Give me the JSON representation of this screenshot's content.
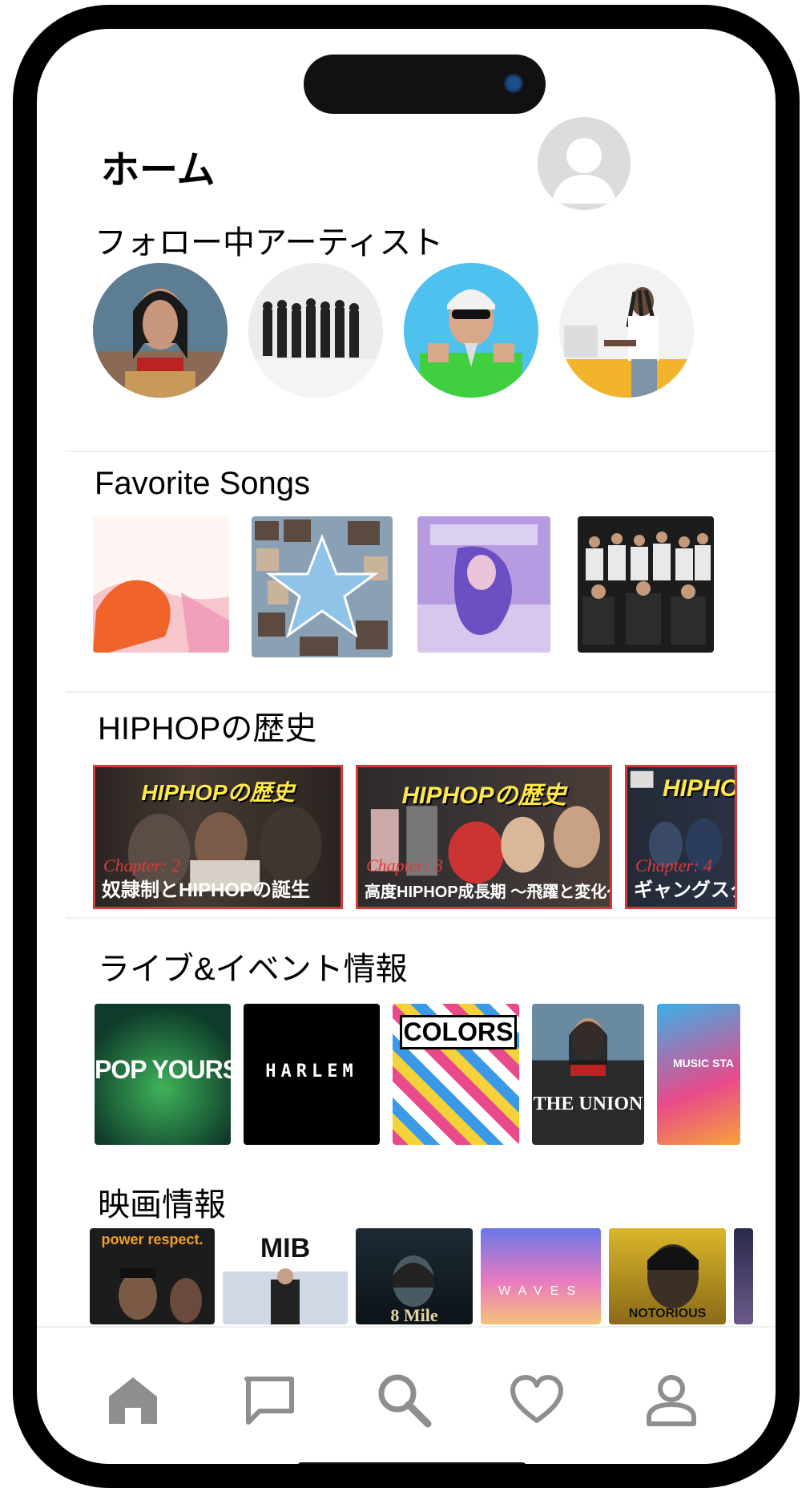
{
  "header": {
    "title": "ホーム",
    "profile_icon": "user-avatar-icon"
  },
  "sections": {
    "artists": {
      "title": "フォロー中アーティスト"
    },
    "songs": {
      "title": "Favorite Songs"
    },
    "history": {
      "title": "HIPHOPの歴史",
      "videos": [
        {
          "badge": "HIPHOPの歴史",
          "chapter": "Chapter: 2",
          "subtitle": "奴隷制とHIPHOPの誕生"
        },
        {
          "badge": "HIPHOPの歴史",
          "chapter": "Chapter: 3",
          "subtitle": "高度HIPHOP成長期 ～飛躍と変化～"
        },
        {
          "badge": "HIPHOP",
          "chapter": "Chapter: 4",
          "subtitle": "ギャングスタラ"
        }
      ]
    },
    "events": {
      "title": "ライブ&イベント情報",
      "items": [
        {
          "label": "POP YOURS"
        },
        {
          "label": "HARLEM"
        },
        {
          "label": "COLORS"
        },
        {
          "label": "THE UNION"
        },
        {
          "label": "MUSIC STA"
        }
      ]
    },
    "movies": {
      "title": "映画情報",
      "items": [
        {
          "label": "power respect."
        },
        {
          "label": "MIB"
        },
        {
          "label": "8 Mile"
        },
        {
          "label": "WAVES"
        },
        {
          "label": "NOTORIOUS"
        }
      ]
    }
  },
  "tabbar": {
    "items": [
      {
        "icon": "home-icon",
        "active": true
      },
      {
        "icon": "chat-icon",
        "active": false
      },
      {
        "icon": "search-icon",
        "active": false
      },
      {
        "icon": "heart-icon",
        "active": false
      },
      {
        "icon": "profile-icon",
        "active": false
      }
    ]
  },
  "colors": {
    "tab_icon": "#8e8e8e",
    "thumb_border": "#d23a3a",
    "badge_yellow": "#ffe84a"
  }
}
